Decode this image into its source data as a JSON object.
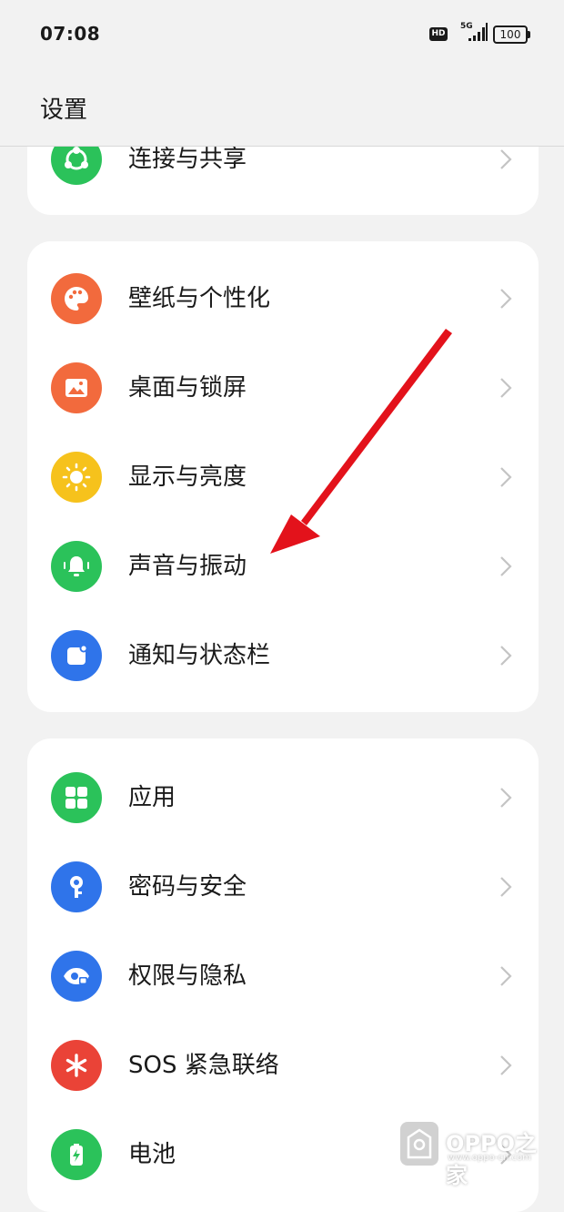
{
  "status_bar": {
    "time": "07:08",
    "hd": "HD",
    "network": "5G",
    "battery": "100"
  },
  "header": {
    "title": "设置"
  },
  "cards": [
    {
      "items": [
        {
          "label": "连接与共享",
          "icon": "share-icon",
          "color": "#2bc25a"
        }
      ]
    },
    {
      "items": [
        {
          "label": "壁纸与个性化",
          "icon": "palette-icon",
          "color": "#f26a3d"
        },
        {
          "label": "桌面与锁屏",
          "icon": "image-icon",
          "color": "#f26a3d"
        },
        {
          "label": "显示与亮度",
          "icon": "sun-icon",
          "color": "#f6c21c"
        },
        {
          "label": "声音与振动",
          "icon": "bell-icon",
          "color": "#2bc25a"
        },
        {
          "label": "通知与状态栏",
          "icon": "notification-icon",
          "color": "#2f74ea"
        }
      ]
    },
    {
      "items": [
        {
          "label": "应用",
          "icon": "apps-grid-icon",
          "color": "#2bc25a"
        },
        {
          "label": "密码与安全",
          "icon": "key-icon",
          "color": "#2f74ea"
        },
        {
          "label": "权限与隐私",
          "icon": "privacy-eye-icon",
          "color": "#2f74ea"
        },
        {
          "label": "SOS 紧急联络",
          "icon": "asterisk-icon",
          "color": "#ea4337"
        },
        {
          "label": "电池",
          "icon": "battery-icon",
          "color": "#2bc25a"
        }
      ]
    }
  ],
  "watermark": {
    "brand": "OPPO之家",
    "url": "www.oppo-cn.com"
  }
}
